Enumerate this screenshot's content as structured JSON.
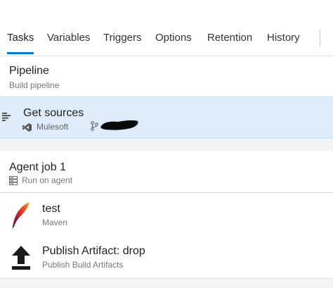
{
  "tabs": [
    {
      "label": "Tasks",
      "active": true
    },
    {
      "label": "Variables"
    },
    {
      "label": "Triggers"
    },
    {
      "label": "Options"
    },
    {
      "label": "Retention"
    },
    {
      "label": "History"
    }
  ],
  "pipeline": {
    "title": "Pipeline",
    "subtitle": "Build pipeline"
  },
  "get_sources": {
    "title": "Get sources",
    "repo": "Mulesoft",
    "repo_icon": "visual-studio-icon",
    "branch_icon": "branch-icon",
    "branch_redacted": true
  },
  "agent_job": {
    "title": "Agent job 1",
    "subtitle": "Run on agent",
    "icon": "server-icon"
  },
  "tasks": [
    {
      "title": "test",
      "subtitle": "Maven",
      "icon": "maven-feather-icon"
    },
    {
      "title": "Publish Artifact: drop",
      "subtitle": "Publish Build Artifacts",
      "icon": "upload-arrow-icon"
    }
  ],
  "colors": {
    "accent": "#0078d4",
    "selected_row": "#deecf9",
    "text_primary": "#222222",
    "text_secondary": "#777777"
  }
}
